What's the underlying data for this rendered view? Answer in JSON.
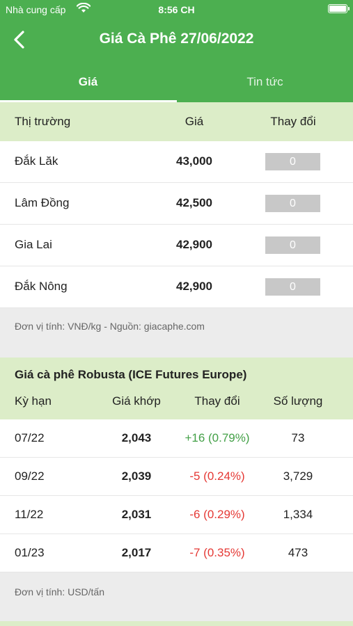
{
  "status_bar": {
    "carrier": "Nhà cung cấp",
    "time": "8:56 CH",
    "wifi_icon": "wifi-icon",
    "battery_icon": "battery-icon"
  },
  "nav": {
    "title": "Giá Cà Phê 27/06/2022",
    "back_icon": "chevron-left-icon"
  },
  "tabs": [
    {
      "label": "Giá",
      "active": true
    },
    {
      "label": "Tin tức",
      "active": false
    }
  ],
  "domestic": {
    "headers": {
      "market": "Thị trường",
      "price": "Giá",
      "change": "Thay đổi"
    },
    "rows": [
      {
        "market": "Đắk Lăk",
        "price": "43,000",
        "change": "0"
      },
      {
        "market": "Lâm Đồng",
        "price": "42,500",
        "change": "0"
      },
      {
        "market": "Gia Lai",
        "price": "42,900",
        "change": "0"
      },
      {
        "market": "Đắk Nông",
        "price": "42,900",
        "change": "0"
      }
    ],
    "note": "Đơn vị tính: VNĐ/kg - Nguồn: giacaphe.com"
  },
  "robusta": {
    "title": "Giá cà phê Robusta (ICE Futures Europe)",
    "headers": {
      "term": "Kỳ hạn",
      "match": "Giá khớp",
      "change": "Thay đổi",
      "volume": "Số lượng"
    },
    "rows": [
      {
        "term": "07/22",
        "match": "2,043",
        "change": "+16 (0.79%)",
        "direction": "up",
        "volume": "73"
      },
      {
        "term": "09/22",
        "match": "2,039",
        "change": "-5 (0.24%)",
        "direction": "down",
        "volume": "3,729"
      },
      {
        "term": "11/22",
        "match": "2,031",
        "change": "-6 (0.29%)",
        "direction": "down",
        "volume": "1,334"
      },
      {
        "term": "01/23",
        "match": "2,017",
        "change": "-7 (0.35%)",
        "direction": "down",
        "volume": "473"
      }
    ],
    "note": "Đơn vị tính: USD/tấn"
  },
  "colors": {
    "header_green": "#4caf50",
    "section_green": "#dcedc8",
    "up": "#43a047",
    "down": "#e53935",
    "badge_gray": "#c8c8c8"
  }
}
